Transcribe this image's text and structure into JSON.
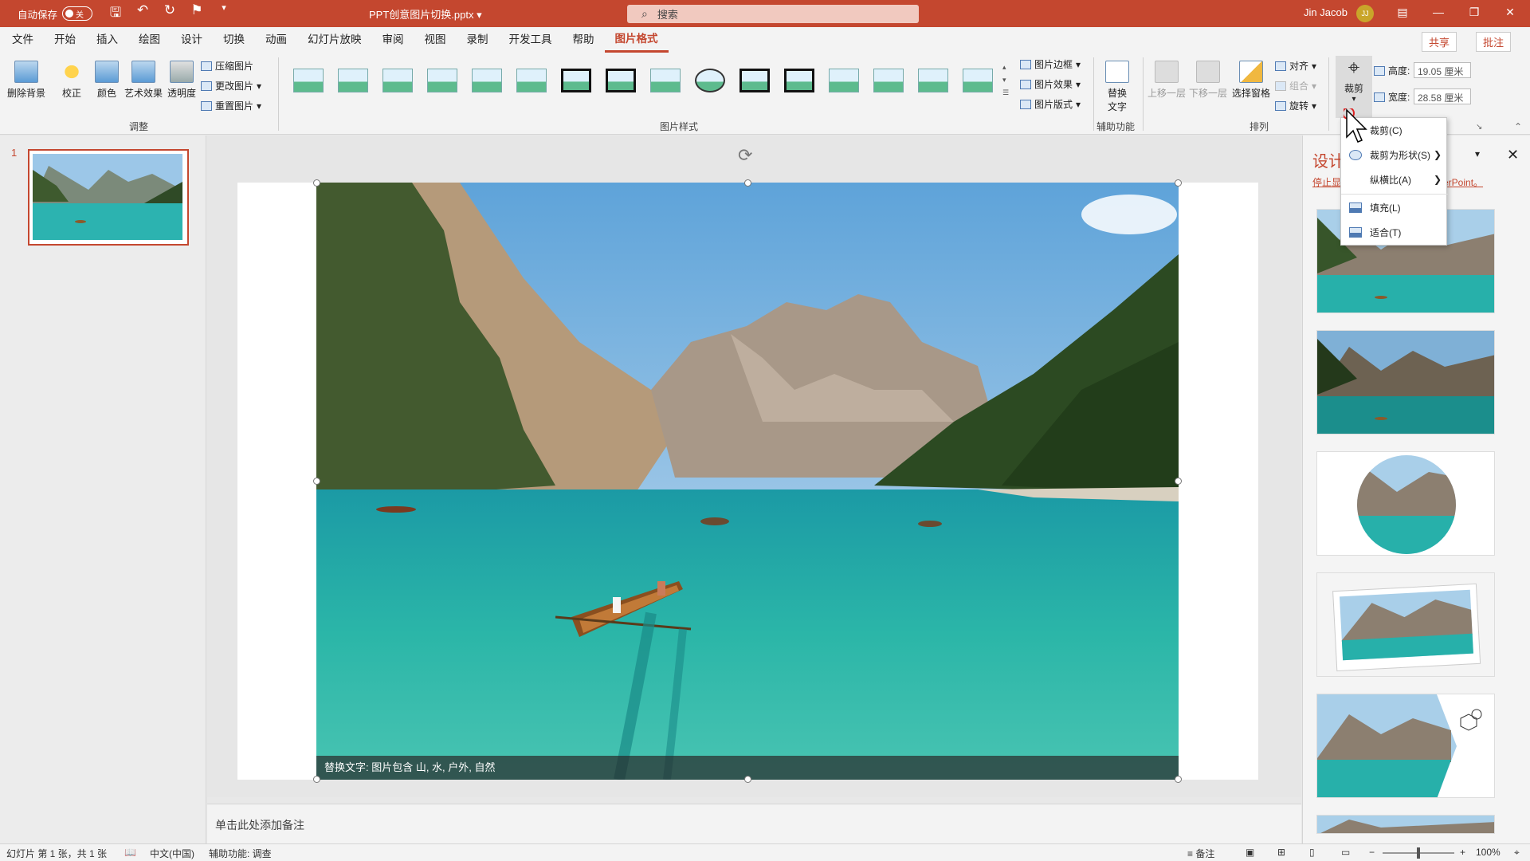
{
  "titlebar": {
    "autosave_label": "自动保存",
    "autosave_state": "关",
    "doc_title": "PPT创意图片切换.pptx",
    "search_placeholder": "搜索",
    "user_name": "Jin Jacob",
    "user_initials": "JJ"
  },
  "menu": {
    "tabs": [
      "文件",
      "开始",
      "插入",
      "绘图",
      "设计",
      "切换",
      "动画",
      "幻灯片放映",
      "审阅",
      "视图",
      "录制",
      "开发工具",
      "帮助",
      "图片格式"
    ],
    "active_tab": "图片格式",
    "share": "共享",
    "comment": "批注"
  },
  "ribbon": {
    "adjust": {
      "remove_bg": "删除背景",
      "correct": "校正",
      "color": "颜色",
      "art_effect": "艺术效果",
      "transparency": "透明度",
      "compress": "压缩图片",
      "change": "更改图片",
      "reset": "重置图片",
      "group_label": "调整"
    },
    "styles": {
      "border": "图片边框",
      "effect": "图片效果",
      "layout": "图片版式",
      "group_label": "图片样式"
    },
    "accessibility": {
      "alt_text": "替换文字",
      "group_label": "辅助功能"
    },
    "arrange": {
      "forward": "上移一层",
      "backward": "下移一层",
      "selection_pane": "选择窗格",
      "align": "对齐",
      "group": "组合",
      "rotate": "旋转",
      "group_label": "排列"
    },
    "size": {
      "crop": "裁剪",
      "height_label": "高度:",
      "height_value": "19.05 厘米",
      "width_label": "宽度:",
      "width_value": "28.58 厘米"
    }
  },
  "crop_menu": {
    "items": [
      "裁剪(C)",
      "裁剪为形状(S)",
      "纵横比(A)",
      "填充(L)",
      "适合(T)"
    ]
  },
  "slides": {
    "number": "1"
  },
  "slide": {
    "alt_text": "替换文字: 图片包含 山, 水, 户外, 自然"
  },
  "notes_placeholder": "单击此处添加备注",
  "design_pane": {
    "title": "设计",
    "link_left": "停止显",
    "link_right": "erPoint。"
  },
  "statusbar": {
    "slide_info": "幻灯片 第 1 张，共 1 张",
    "language": "中文(中国)",
    "accessibility": "辅助功能: 调查",
    "notes": "备注",
    "zoom": "100%"
  },
  "colors": {
    "brand": "#c4472f"
  }
}
